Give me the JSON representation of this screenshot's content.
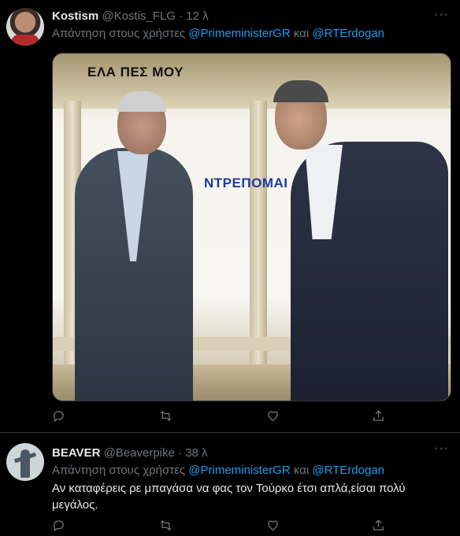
{
  "tweets": [
    {
      "name": "Kostism",
      "handle": "@Kostis_FLG",
      "separator": "·",
      "time": "12 λ",
      "reply_prefix": "Απάντηση στους χρήστες",
      "mention1": "@PrimeministerGR",
      "reply_and": "και",
      "mention2": "@RTErdogan",
      "more": "···",
      "media_text": {
        "top": "ΕΛΑ ΠΕΣ ΜΟΥ",
        "middle": "ΝΤΡΕΠΟΜΑΙ"
      }
    },
    {
      "name": "BEAVER",
      "handle": "@Beaverpike",
      "separator": "·",
      "time": "38 λ",
      "reply_prefix": "Απάντηση στους χρήστες",
      "mention1": "@PrimeministerGR",
      "reply_and": "και",
      "mention2": "@RTErdogan",
      "more": "···",
      "text": "Αν καταφέρεις ρε μπαγάσα να  φας τον Τούρκο έτσι απλά,είσαι πολύ μεγάλος."
    }
  ],
  "icons": [
    "reply-icon",
    "retweet-icon",
    "like-icon",
    "share-icon"
  ],
  "colors": {
    "background": "#000000",
    "text": "#e7e9ea",
    "muted": "#71767b",
    "link": "#1d9bf0"
  }
}
